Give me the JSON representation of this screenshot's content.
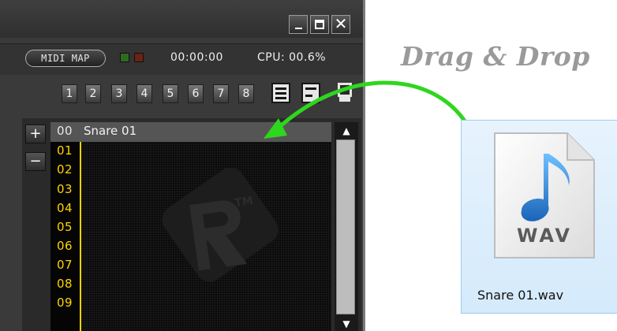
{
  "window": {
    "controls": {
      "minimize_icon": "minimize-icon",
      "maximize_icon": "maximize-icon",
      "close_glyph": "✕"
    }
  },
  "status": {
    "midi_map_label": "MIDI MAP",
    "time": "00:00:00",
    "cpu": "CPU: 00.6%"
  },
  "toolbar": {
    "channels": [
      "1",
      "2",
      "3",
      "4",
      "5",
      "6",
      "7",
      "8"
    ]
  },
  "list": {
    "add_label": "+",
    "remove_label": "−",
    "rows": [
      {
        "num": "00",
        "name": "Snare 01"
      },
      {
        "num": "01",
        "name": ""
      },
      {
        "num": "02",
        "name": ""
      },
      {
        "num": "03",
        "name": ""
      },
      {
        "num": "04",
        "name": ""
      },
      {
        "num": "05",
        "name": ""
      },
      {
        "num": "06",
        "name": ""
      },
      {
        "num": "07",
        "name": ""
      },
      {
        "num": "08",
        "name": ""
      },
      {
        "num": "09",
        "name": ""
      }
    ],
    "selected_index": 0,
    "scroll_up_glyph": "▲",
    "scroll_down_glyph": "▼"
  },
  "drag_drop": {
    "label": "Drag & Drop",
    "arrow_color": "#2fd61e"
  },
  "file": {
    "icon_label": "WAV",
    "name": "Snare 01.wav",
    "note_color": "#2f7fd0"
  },
  "colors": {
    "accent_yellow": "#ffd400",
    "selection_bg": "#555555"
  }
}
